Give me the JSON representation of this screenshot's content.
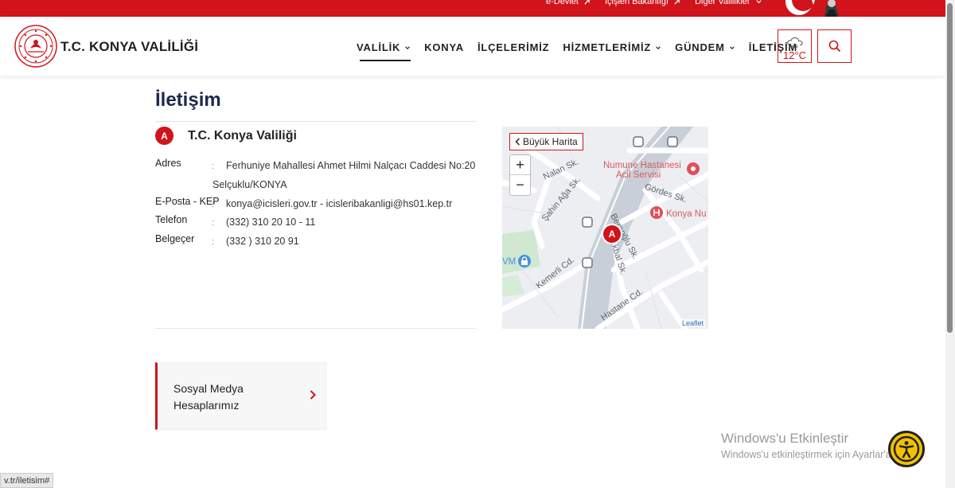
{
  "topbar": {
    "links": [
      "e-Devlet",
      "İçişleri Bakanlığı",
      "Diğer Valilikler"
    ]
  },
  "header": {
    "logo_text": "T.C. KONYA VALİLİĞİ",
    "nav": [
      {
        "label": "VALİLİK",
        "has_dropdown": true,
        "active": true
      },
      {
        "label": "KONYA",
        "has_dropdown": false
      },
      {
        "label": "İLÇELERİMİZ",
        "has_dropdown": false
      },
      {
        "label": "HİZMETLERİMİZ",
        "has_dropdown": true
      },
      {
        "label": "GÜNDEM",
        "has_dropdown": true
      },
      {
        "label": "İLETİŞİM",
        "has_dropdown": false
      }
    ],
    "weather": {
      "temp": "12°C",
      "icon": "cloud-rain-icon"
    }
  },
  "page": {
    "title": "İletişim",
    "marker": "A",
    "office_name": "T.C. Konya Valiliği",
    "info": {
      "address_label": "Adres",
      "address_line1": "Ferhuniye Mahallesi Ahmet Hilmi Nalçacı Caddesi No:20",
      "address_line2": "Selçuklu/KONYA",
      "email_label": "E-Posta - KEP",
      "email_value": "konya@icisleri.gov.tr - icisleribakanligi@hs01.kep.tr",
      "phone_label": "Telefon",
      "phone_value": "(332) 310 20 10 - 11",
      "fax_label": "Belgeçer",
      "fax_value": "(332 ) 310 20 91",
      "colon": ":"
    }
  },
  "map": {
    "big_map_label": "Büyük Harita",
    "zoom_in": "+",
    "zoom_out": "−",
    "poi_hospital_line1": "Numune Hastanesi",
    "poi_hospital_line2": "Acil Servisi",
    "poi_konya": "Konya Nu",
    "poi_avm": "VM",
    "streets": [
      "Nalan Sk.",
      "Şahin Ağa Sk.",
      "Gördes Sk.",
      "Kemerli Cd.",
      "Hastane Cd.",
      "Beraoğlu Sk.",
      "İkbal Sk."
    ],
    "pin_label": "A",
    "attribution": "Leaflet"
  },
  "social": {
    "label": "Sosyal Medya Hesaplarımız"
  },
  "windows_watermark": {
    "line1": "Windows'u Etkinleştir",
    "line2": "Windows'u etkinleştirmek için Ayarlar'a"
  },
  "status_bar": {
    "url": "v.tr/iletisim#"
  },
  "colors": {
    "brand_red": "#d1141b",
    "title_navy": "#1b2a4a"
  }
}
